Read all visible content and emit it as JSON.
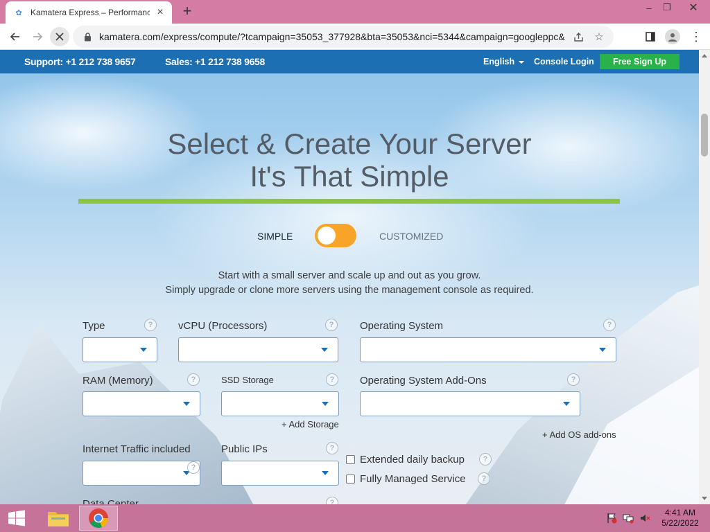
{
  "browser": {
    "tab_title": "Kamatera Express – Performance",
    "url": "kamatera.com/express/compute/?tcampaign=35053_377928&bta=35053&nci=5344&campaign=googleppc&gc..."
  },
  "topbar": {
    "support": "Support: +1 212 738 9657",
    "sales": "Sales: +1 212 738 9658",
    "language": "English",
    "console_login": "Console Login",
    "signup": "Free Sign Up"
  },
  "hero": {
    "title_line1": "Select & Create Your Server",
    "title_line2": "It's That Simple"
  },
  "mode": {
    "simple": "SIMPLE",
    "customized": "CUSTOMIZED",
    "selected": "SIMPLE"
  },
  "intro": {
    "line1": "Start with a small server and scale up and out as you grow.",
    "line2": "Simply upgrade or clone more servers using the management console as required."
  },
  "form": {
    "type_label": "Type",
    "vcpu_label": "vCPU (Processors)",
    "os_label": "Operating System",
    "ram_label": "RAM (Memory)",
    "ssd_label": "SSD Storage",
    "os_addons_label": "Operating System Add-Ons",
    "add_storage": "+ Add Storage",
    "add_os_addons": "+ Add OS add-ons",
    "traffic_label": "Internet Traffic included",
    "public_ips_label": "Public IPs",
    "daily_backup_label": "Extended daily backup",
    "managed_service_label": "Fully Managed Service",
    "datacenter_label": "Data Center",
    "help_glyph": "?"
  },
  "taskbar": {
    "time": "4:41 AM",
    "date": "5/22/2022"
  },
  "colors": {
    "brand_blue": "#1d6fb4",
    "signup_green": "#2ab24a",
    "accent_green": "#8cc63f",
    "toggle_orange": "#f7a429",
    "chrome_pink": "#d57ca3"
  }
}
